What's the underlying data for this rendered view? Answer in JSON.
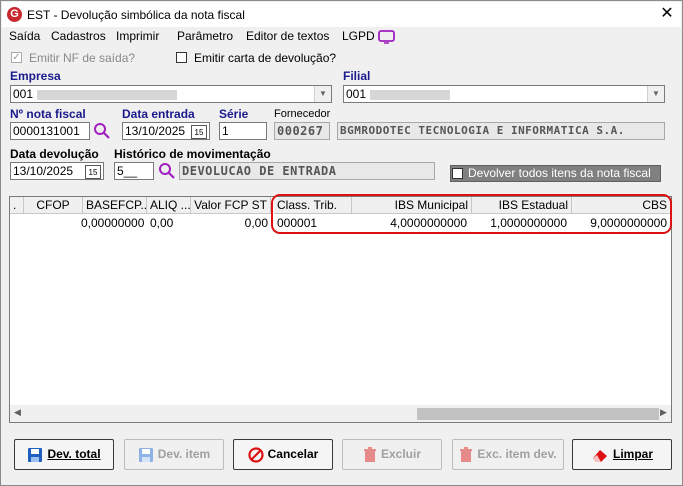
{
  "window": {
    "title": "EST - Devolução simbólica da nota fiscal",
    "logo_letter": "G",
    "close_symbol": "✕"
  },
  "menu": {
    "items": [
      "Saída",
      "Cadastros",
      "Imprimir",
      "Parâmetro",
      "Editor de textos",
      "LGPD"
    ]
  },
  "options": {
    "emitir_nf_saida": "Emitir NF de saída?",
    "emitir_carta": "Emitir carta de devolução?"
  },
  "empresa": {
    "label": "Empresa",
    "value": "001"
  },
  "filial": {
    "label": "Filial",
    "value": "001"
  },
  "nota_fiscal": {
    "label": "Nº nota fiscal",
    "value": "0000131001"
  },
  "data_entrada": {
    "label": "Data entrada",
    "value": "13/10/2025"
  },
  "serie": {
    "label": "Série",
    "value": "1"
  },
  "fornecedor": {
    "label": "Fornecedor",
    "code": "000267",
    "name": "BGMRODOTEC TECNOLOGIA E INFORMATICA S.A."
  },
  "data_devolucao": {
    "label": "Data devolução",
    "value": "13/10/2025"
  },
  "historico": {
    "label": "Histórico de movimentação",
    "code": "5__",
    "description": "DEVOLUCAO DE ENTRADA"
  },
  "devolver_todos": {
    "label": "Devolver todos itens da nota fiscal"
  },
  "grid": {
    "columns": [
      ".",
      "CFOP",
      "BASEFCP...",
      "ALIQ ...",
      "Valor FCP ST",
      "Class. Trib.",
      "IBS Municipal",
      "IBS Estadual",
      "CBS"
    ],
    "row": {
      "cfop": "",
      "basefcp": "0,00000000",
      "aliq": "0,00",
      "valor_fcp_st": "0,00",
      "class_trib": "000001",
      "ibs_municipal": "4,0000000000",
      "ibs_estadual": "1,0000000000",
      "cbs": "9,0000000000"
    }
  },
  "buttons": {
    "dev_total": "Dev. total",
    "dev_item": "Dev. item",
    "cancelar": "Cancelar",
    "excluir": "Excluir",
    "exc_item_dev": "Exc. item dev.",
    "limpar": "Limpar"
  },
  "colors": {
    "accent_red": "#d11111",
    "label_blue": "#1a1a8c",
    "button_blue": "#1f5fbf"
  }
}
